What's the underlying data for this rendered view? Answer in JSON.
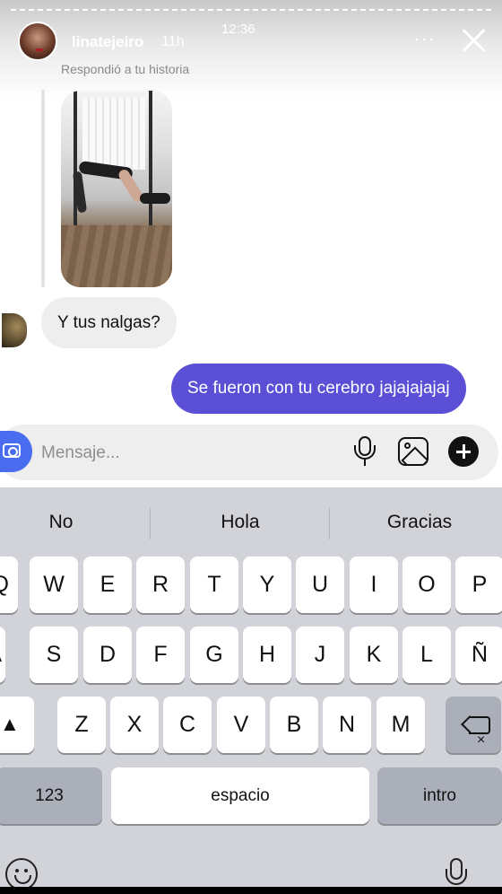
{
  "status": {
    "time": "12:36"
  },
  "header": {
    "username": "linatejeiro",
    "age": "11h",
    "more_label": "···",
    "replied_label": "Respondió a tu historia"
  },
  "messages": [
    {
      "from": "them",
      "text": "Y tus nalgas?"
    },
    {
      "from": "me",
      "text": "Se fueron con tu cerebro jajajajajaj"
    }
  ],
  "composer": {
    "placeholder": "Mensaje...",
    "value": ""
  },
  "keyboard": {
    "suggestions": [
      "No",
      "Hola",
      "Gracias"
    ],
    "row1": [
      "Q",
      "W",
      "E",
      "R",
      "T",
      "Y",
      "U",
      "I",
      "O",
      "P"
    ],
    "row2": [
      "A",
      "S",
      "D",
      "F",
      "G",
      "H",
      "J",
      "K",
      "L",
      "Ñ"
    ],
    "row3": [
      "Z",
      "X",
      "C",
      "V",
      "B",
      "N",
      "M"
    ],
    "numbers_label": "123",
    "space_label": "espacio",
    "return_label": "intro"
  },
  "colors": {
    "accent": "#5b4fd6",
    "camera": "#4a6cf0",
    "keyboard_bg": "#d1d3d9"
  }
}
